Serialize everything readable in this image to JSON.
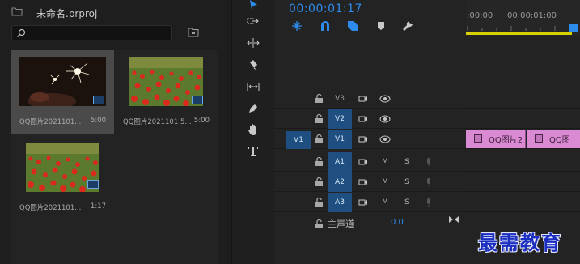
{
  "project": {
    "title": "未命名.prproj",
    "search": {
      "value": ""
    },
    "clips": [
      {
        "name": "QQ图片2021101...",
        "duration": "5:00",
        "thumb": "sparkler-icon",
        "selected": true
      },
      {
        "name": "QQ图片2021101 5...",
        "duration": "5:00",
        "thumb": "poppy-field-icon",
        "selected": false
      },
      {
        "name": "QQ图片2021101...",
        "duration": "1:17",
        "thumb": "poppy-field-icon",
        "selected": false
      }
    ]
  },
  "tools": [
    "selection-tool",
    "track-select-tool",
    "ripple-edit-tool",
    "razor-tool",
    "slip-tool",
    "pen-tool",
    "hand-tool",
    "type-tool"
  ],
  "timeline": {
    "timecode": "00:00:01:17",
    "ruler": {
      "start": ":00:00",
      "mid": "00:00:01:00"
    },
    "source_patch": "V1",
    "video_tracks": [
      {
        "label": "V3",
        "target": false
      },
      {
        "label": "V2",
        "target": true
      },
      {
        "label": "V1",
        "target": true
      }
    ],
    "audio_tracks": [
      {
        "label": "A1",
        "m": "M",
        "s": "S"
      },
      {
        "label": "A2",
        "m": "M",
        "s": "S"
      },
      {
        "label": "A3",
        "m": "M",
        "s": "S"
      }
    ],
    "clips": [
      {
        "label": "QQ图片2",
        "color": "#d98ad2"
      },
      {
        "label": "QQ图",
        "color": "#d98ad2"
      }
    ],
    "master": {
      "label": "主声道",
      "value": "0.0"
    }
  },
  "watermark": "最需教育",
  "colors": {
    "accent": "#2d8ceb",
    "track_target": "#1e4f80",
    "clip": "#d98ad2",
    "workarea": "#d8d000"
  }
}
